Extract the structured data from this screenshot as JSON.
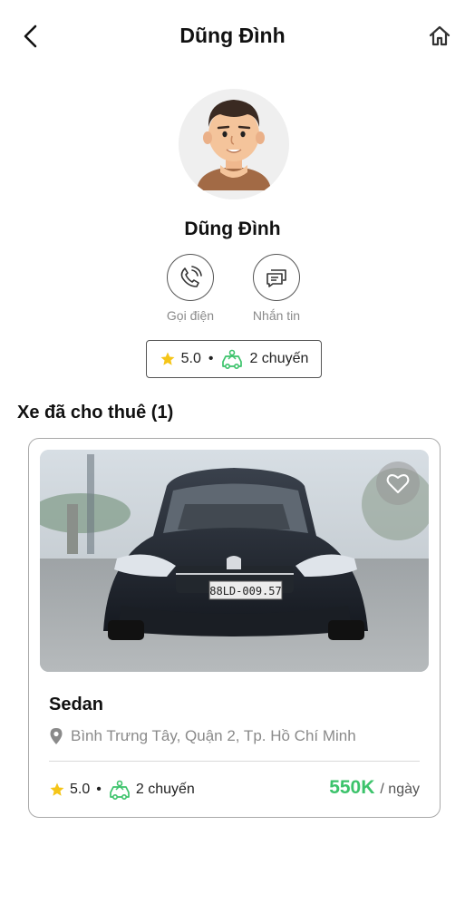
{
  "header": {
    "title": "Dũng Đình",
    "back_icon": "chevron-left-icon",
    "home_icon": "home-icon"
  },
  "profile": {
    "name": "Dũng Đình",
    "avatar_icon": "avatar-man-icon"
  },
  "actions": {
    "call_label": "Gọi điện",
    "message_label": "Nhắn tin"
  },
  "owner_stats": {
    "rating": "5.0",
    "trips": "2 chuyến"
  },
  "section": {
    "title": "Xe đã cho thuê (1)"
  },
  "cars": [
    {
      "name": "Sedan",
      "location": "Bình Trưng Tây, Quận 2, Tp. Hồ Chí Minh",
      "rating": "5.0",
      "trips": "2 chuyến",
      "price": "550K",
      "price_unit": "/ ngày",
      "plate": "88LD-009.57",
      "favorite_icon": "heart-outline-icon"
    }
  ],
  "colors": {
    "price": "#3cc36b",
    "star": "#f5c518",
    "trip_icon": "#3cc36b"
  }
}
